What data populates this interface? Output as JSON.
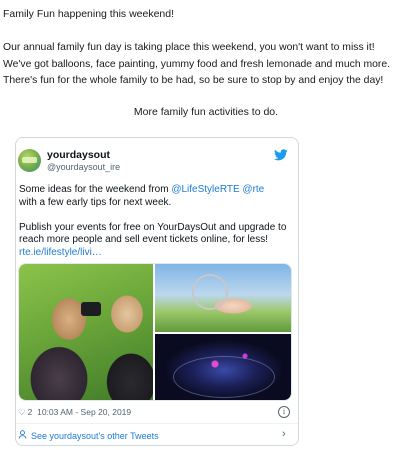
{
  "post": {
    "title": "Family Fun happening this weekend!",
    "body": "Our annual family fun day is taking place this weekend, you won't want to miss it! We've got balloons, face painting, yummy food and fresh lemonade and much more. There's fun for the whole family to be had, so be sure to stop by and enjoy the day!",
    "more_link": "More family fun activities to do."
  },
  "tweet": {
    "name": "yourdaysout",
    "handle": "@yourdaysout_ire",
    "line1_prefix": "Some ideas for the weekend from ",
    "mention1": "@LifeStyleRTE",
    "mention2": "@rte",
    "line2": " with a few early tips for next week.",
    "para2": "Publish your events for free on YourDaysOut and upgrade to reach more people and sell event tickets online, for less!",
    "url": "rte.ie/lifestyle/livi…",
    "likes": "2",
    "timestamp": "10:03 AM - Sep 20, 2019",
    "other_tweets": "See yourdaysout's other Tweets"
  },
  "icons": {
    "brand": "twitter-bird-icon",
    "like": "heart-icon",
    "info": "info-icon",
    "profile": "person-icon",
    "next": "chevron-right-icon"
  },
  "colors": {
    "link": "#1d7bd8",
    "twitter_blue": "#1d9bf0",
    "muted": "#536471"
  }
}
